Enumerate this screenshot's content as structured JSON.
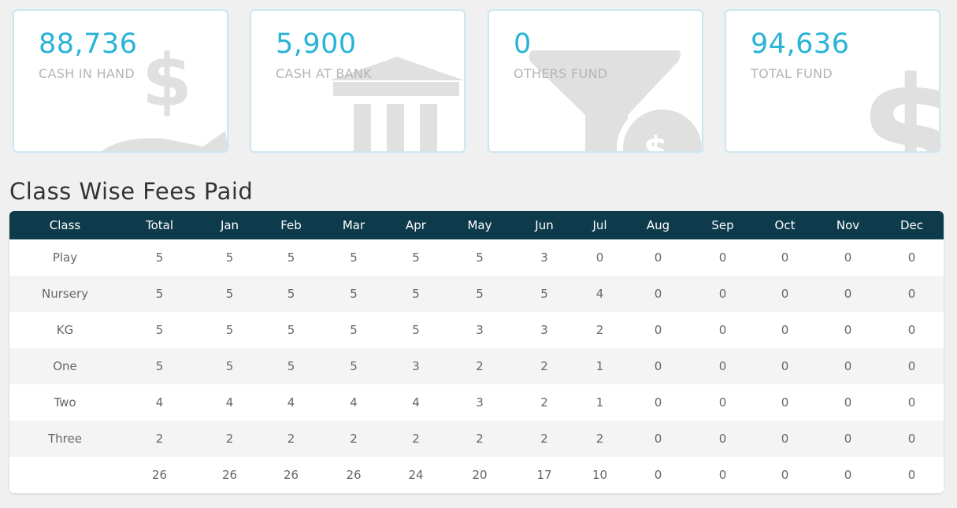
{
  "cards": [
    {
      "value": "88,736",
      "label": "CASH IN HAND",
      "icon": "dollar-hand-icon"
    },
    {
      "value": "5,900",
      "label": "CASH AT BANK",
      "icon": "bank-icon"
    },
    {
      "value": "0",
      "label": "OTHERS FUND",
      "icon": "funnel-dollar-icon"
    },
    {
      "value": "94,636",
      "label": "TOTAL FUND",
      "icon": "dollar-icon"
    }
  ],
  "section_title": "Class Wise Fees Paid",
  "table": {
    "columns": [
      "Class",
      "Total",
      "Jan",
      "Feb",
      "Mar",
      "Apr",
      "May",
      "Jun",
      "Jul",
      "Aug",
      "Sep",
      "Oct",
      "Nov",
      "Dec"
    ],
    "rows": [
      [
        "Play",
        "5",
        "5",
        "5",
        "5",
        "5",
        "5",
        "3",
        "0",
        "0",
        "0",
        "0",
        "0",
        "0"
      ],
      [
        "Nursery",
        "5",
        "5",
        "5",
        "5",
        "5",
        "5",
        "5",
        "4",
        "0",
        "0",
        "0",
        "0",
        "0"
      ],
      [
        "KG",
        "5",
        "5",
        "5",
        "5",
        "5",
        "3",
        "3",
        "2",
        "0",
        "0",
        "0",
        "0",
        "0"
      ],
      [
        "One",
        "5",
        "5",
        "5",
        "5",
        "3",
        "2",
        "2",
        "1",
        "0",
        "0",
        "0",
        "0",
        "0"
      ],
      [
        "Two",
        "4",
        "4",
        "4",
        "4",
        "4",
        "3",
        "2",
        "1",
        "0",
        "0",
        "0",
        "0",
        "0"
      ],
      [
        "Three",
        "2",
        "2",
        "2",
        "2",
        "2",
        "2",
        "2",
        "2",
        "0",
        "0",
        "0",
        "0",
        "0"
      ],
      [
        "",
        "26",
        "26",
        "26",
        "26",
        "24",
        "20",
        "17",
        "10",
        "0",
        "0",
        "0",
        "0",
        "0"
      ]
    ]
  },
  "colors": {
    "accent": "#29b3d6",
    "header_bg": "#0e3b4c",
    "card_border": "#cfe6ee",
    "icon_gray": "#e0e0e0"
  }
}
